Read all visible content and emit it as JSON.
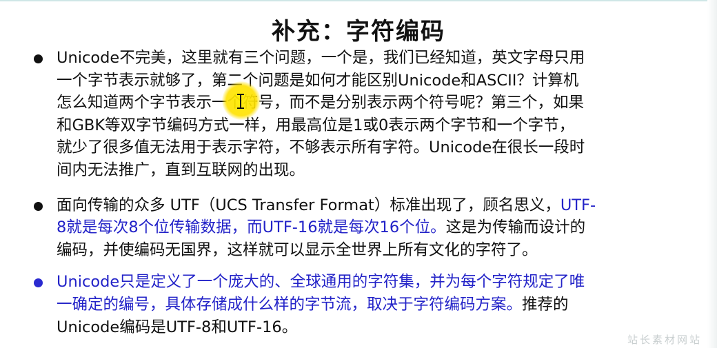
{
  "slide": {
    "title": "补充：字符编码",
    "bullets": [
      {
        "lines": [
          "Unicode不完美，这里就有三个问题，一个是，我们已经知道，英文字母只用",
          "一个字节表示就够了，第二个问题是如何才能区别Unicode和ASCII？计算机",
          "怎么知道两个字节表示一个符号，而不是分别表示两个符号呢？第三个，如果",
          "和GBK等双字节编码方式一样，用最高位是1或0表示两个字节和一个字节，",
          "就少了很多值无法用于表示字符，不够表示所有字符。Unicode在很长一段时",
          "间内无法推广，直到互联网的出现。"
        ]
      },
      {
        "line1_plain": "面向传输的众多 UTF（UCS Transfer Format）标准出现了，顾名思义，",
        "line1_blue": "UTF-",
        "line2_blue": "8就是每次8个位传输数据，而UTF-16就是每次16个位。",
        "line2_plain": "这是为传输而设计的",
        "line3_plain": "编码，并使编码无国界，这样就可以显示全世界上所有文化的字符了。"
      },
      {
        "line1_blue": "Unicode只是定义了一个庞大的、全球通用的字符集，并为每个字符规定了唯",
        "line2_blue": "一确定的编号，具体存储成什么样的字节流，取决于字符编码方案。",
        "line2_plain": "推荐的",
        "line3_plain": "Unicode编码是UTF-8和UTF-16。"
      }
    ],
    "watermark": "站长素材网站"
  },
  "colors": {
    "highlight_text": "#2323c8",
    "cursor_highlight": "#ffe600"
  }
}
